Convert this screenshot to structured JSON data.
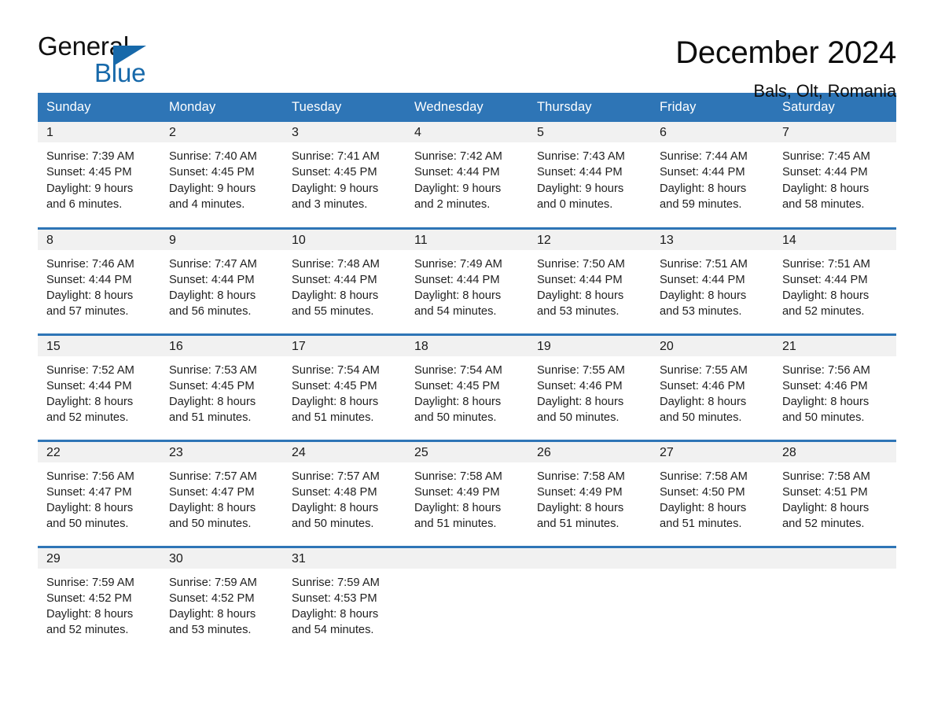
{
  "brand": {
    "name_part1": "General",
    "name_part2": "Blue",
    "triangle_icon": "triangle-logo-mark",
    "accent_color": "#1769aa"
  },
  "header": {
    "month_title": "December 2024",
    "location": "Bals, Olt, Romania"
  },
  "calendar": {
    "header_color": "#2e75b6",
    "daynum_band_color": "#f1f1f1",
    "weekday_headers": [
      "Sunday",
      "Monday",
      "Tuesday",
      "Wednesday",
      "Thursday",
      "Friday",
      "Saturday"
    ],
    "weeks": [
      [
        {
          "day": "1",
          "sunrise": "Sunrise: 7:39 AM",
          "sunset": "Sunset: 4:45 PM",
          "daylight_line1": "Daylight: 9 hours",
          "daylight_line2": "and 6 minutes."
        },
        {
          "day": "2",
          "sunrise": "Sunrise: 7:40 AM",
          "sunset": "Sunset: 4:45 PM",
          "daylight_line1": "Daylight: 9 hours",
          "daylight_line2": "and 4 minutes."
        },
        {
          "day": "3",
          "sunrise": "Sunrise: 7:41 AM",
          "sunset": "Sunset: 4:45 PM",
          "daylight_line1": "Daylight: 9 hours",
          "daylight_line2": "and 3 minutes."
        },
        {
          "day": "4",
          "sunrise": "Sunrise: 7:42 AM",
          "sunset": "Sunset: 4:44 PM",
          "daylight_line1": "Daylight: 9 hours",
          "daylight_line2": "and 2 minutes."
        },
        {
          "day": "5",
          "sunrise": "Sunrise: 7:43 AM",
          "sunset": "Sunset: 4:44 PM",
          "daylight_line1": "Daylight: 9 hours",
          "daylight_line2": "and 0 minutes."
        },
        {
          "day": "6",
          "sunrise": "Sunrise: 7:44 AM",
          "sunset": "Sunset: 4:44 PM",
          "daylight_line1": "Daylight: 8 hours",
          "daylight_line2": "and 59 minutes."
        },
        {
          "day": "7",
          "sunrise": "Sunrise: 7:45 AM",
          "sunset": "Sunset: 4:44 PM",
          "daylight_line1": "Daylight: 8 hours",
          "daylight_line2": "and 58 minutes."
        }
      ],
      [
        {
          "day": "8",
          "sunrise": "Sunrise: 7:46 AM",
          "sunset": "Sunset: 4:44 PM",
          "daylight_line1": "Daylight: 8 hours",
          "daylight_line2": "and 57 minutes."
        },
        {
          "day": "9",
          "sunrise": "Sunrise: 7:47 AM",
          "sunset": "Sunset: 4:44 PM",
          "daylight_line1": "Daylight: 8 hours",
          "daylight_line2": "and 56 minutes."
        },
        {
          "day": "10",
          "sunrise": "Sunrise: 7:48 AM",
          "sunset": "Sunset: 4:44 PM",
          "daylight_line1": "Daylight: 8 hours",
          "daylight_line2": "and 55 minutes."
        },
        {
          "day": "11",
          "sunrise": "Sunrise: 7:49 AM",
          "sunset": "Sunset: 4:44 PM",
          "daylight_line1": "Daylight: 8 hours",
          "daylight_line2": "and 54 minutes."
        },
        {
          "day": "12",
          "sunrise": "Sunrise: 7:50 AM",
          "sunset": "Sunset: 4:44 PM",
          "daylight_line1": "Daylight: 8 hours",
          "daylight_line2": "and 53 minutes."
        },
        {
          "day": "13",
          "sunrise": "Sunrise: 7:51 AM",
          "sunset": "Sunset: 4:44 PM",
          "daylight_line1": "Daylight: 8 hours",
          "daylight_line2": "and 53 minutes."
        },
        {
          "day": "14",
          "sunrise": "Sunrise: 7:51 AM",
          "sunset": "Sunset: 4:44 PM",
          "daylight_line1": "Daylight: 8 hours",
          "daylight_line2": "and 52 minutes."
        }
      ],
      [
        {
          "day": "15",
          "sunrise": "Sunrise: 7:52 AM",
          "sunset": "Sunset: 4:44 PM",
          "daylight_line1": "Daylight: 8 hours",
          "daylight_line2": "and 52 minutes."
        },
        {
          "day": "16",
          "sunrise": "Sunrise: 7:53 AM",
          "sunset": "Sunset: 4:45 PM",
          "daylight_line1": "Daylight: 8 hours",
          "daylight_line2": "and 51 minutes."
        },
        {
          "day": "17",
          "sunrise": "Sunrise: 7:54 AM",
          "sunset": "Sunset: 4:45 PM",
          "daylight_line1": "Daylight: 8 hours",
          "daylight_line2": "and 51 minutes."
        },
        {
          "day": "18",
          "sunrise": "Sunrise: 7:54 AM",
          "sunset": "Sunset: 4:45 PM",
          "daylight_line1": "Daylight: 8 hours",
          "daylight_line2": "and 50 minutes."
        },
        {
          "day": "19",
          "sunrise": "Sunrise: 7:55 AM",
          "sunset": "Sunset: 4:46 PM",
          "daylight_line1": "Daylight: 8 hours",
          "daylight_line2": "and 50 minutes."
        },
        {
          "day": "20",
          "sunrise": "Sunrise: 7:55 AM",
          "sunset": "Sunset: 4:46 PM",
          "daylight_line1": "Daylight: 8 hours",
          "daylight_line2": "and 50 minutes."
        },
        {
          "day": "21",
          "sunrise": "Sunrise: 7:56 AM",
          "sunset": "Sunset: 4:46 PM",
          "daylight_line1": "Daylight: 8 hours",
          "daylight_line2": "and 50 minutes."
        }
      ],
      [
        {
          "day": "22",
          "sunrise": "Sunrise: 7:56 AM",
          "sunset": "Sunset: 4:47 PM",
          "daylight_line1": "Daylight: 8 hours",
          "daylight_line2": "and 50 minutes."
        },
        {
          "day": "23",
          "sunrise": "Sunrise: 7:57 AM",
          "sunset": "Sunset: 4:47 PM",
          "daylight_line1": "Daylight: 8 hours",
          "daylight_line2": "and 50 minutes."
        },
        {
          "day": "24",
          "sunrise": "Sunrise: 7:57 AM",
          "sunset": "Sunset: 4:48 PM",
          "daylight_line1": "Daylight: 8 hours",
          "daylight_line2": "and 50 minutes."
        },
        {
          "day": "25",
          "sunrise": "Sunrise: 7:58 AM",
          "sunset": "Sunset: 4:49 PM",
          "daylight_line1": "Daylight: 8 hours",
          "daylight_line2": "and 51 minutes."
        },
        {
          "day": "26",
          "sunrise": "Sunrise: 7:58 AM",
          "sunset": "Sunset: 4:49 PM",
          "daylight_line1": "Daylight: 8 hours",
          "daylight_line2": "and 51 minutes."
        },
        {
          "day": "27",
          "sunrise": "Sunrise: 7:58 AM",
          "sunset": "Sunset: 4:50 PM",
          "daylight_line1": "Daylight: 8 hours",
          "daylight_line2": "and 51 minutes."
        },
        {
          "day": "28",
          "sunrise": "Sunrise: 7:58 AM",
          "sunset": "Sunset: 4:51 PM",
          "daylight_line1": "Daylight: 8 hours",
          "daylight_line2": "and 52 minutes."
        }
      ],
      [
        {
          "day": "29",
          "sunrise": "Sunrise: 7:59 AM",
          "sunset": "Sunset: 4:52 PM",
          "daylight_line1": "Daylight: 8 hours",
          "daylight_line2": "and 52 minutes."
        },
        {
          "day": "30",
          "sunrise": "Sunrise: 7:59 AM",
          "sunset": "Sunset: 4:52 PM",
          "daylight_line1": "Daylight: 8 hours",
          "daylight_line2": "and 53 minutes."
        },
        {
          "day": "31",
          "sunrise": "Sunrise: 7:59 AM",
          "sunset": "Sunset: 4:53 PM",
          "daylight_line1": "Daylight: 8 hours",
          "daylight_line2": "and 54 minutes."
        },
        {
          "day": "",
          "sunrise": "",
          "sunset": "",
          "daylight_line1": "",
          "daylight_line2": ""
        },
        {
          "day": "",
          "sunrise": "",
          "sunset": "",
          "daylight_line1": "",
          "daylight_line2": ""
        },
        {
          "day": "",
          "sunrise": "",
          "sunset": "",
          "daylight_line1": "",
          "daylight_line2": ""
        },
        {
          "day": "",
          "sunrise": "",
          "sunset": "",
          "daylight_line1": "",
          "daylight_line2": ""
        }
      ]
    ]
  }
}
